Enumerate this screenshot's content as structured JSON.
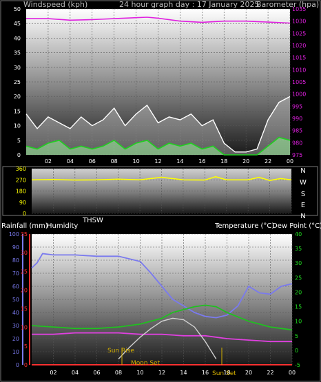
{
  "header": {
    "left": "Windspeed (kph)",
    "center": "24 hour graph day : 17 January 2025",
    "right": "Barometer (hpa)"
  },
  "direction_letters": [
    "N",
    "W",
    "S",
    "E",
    "N"
  ],
  "labels": {
    "rainfall": "Rainfall (mm)",
    "humidity": "Humidity",
    "thsw": "THSW",
    "temperature": "Temperature (°C)",
    "dewpoint": "Dew Point (°C)",
    "sunrise": "Sun Rise",
    "moonset": "Moon Set",
    "sunset": "Sun Set"
  },
  "colors": {
    "barometer": "#e020e0",
    "wind_gust": "#ffffff",
    "wind_avg": "#20d020",
    "wind_dir": "#ffff00",
    "humidity": "#7a7aee",
    "temperature": "#e040e0",
    "dewpoint": "#20c020",
    "solar": "#d0d0d0",
    "rain": "#ff3030"
  },
  "chart_data": [
    {
      "type": "line",
      "x_tick_labels": [
        "02",
        "04",
        "06",
        "08",
        "10",
        "12",
        "14",
        "16",
        "18",
        "20",
        "22",
        "00"
      ],
      "y_left": {
        "label": "Windspeed (kph)",
        "range": [
          0,
          50
        ],
        "ticks": [
          0,
          5,
          10,
          15,
          20,
          25,
          30,
          35,
          40,
          45,
          50
        ]
      },
      "y_right": {
        "label": "Barometer (hpa)",
        "range": [
          975,
          1035
        ],
        "ticks": [
          975,
          980,
          985,
          990,
          995,
          1000,
          1005,
          1010,
          1015,
          1020,
          1025,
          1030,
          1035
        ]
      },
      "series": [
        {
          "name": "Barometer",
          "axis": "right",
          "x": [
            0,
            2,
            4,
            6,
            8,
            10,
            11,
            12,
            14,
            16,
            18,
            20,
            22,
            24
          ],
          "values": [
            1031,
            1031,
            1030.4,
            1030.6,
            1031,
            1031.4,
            1031.6,
            1031.2,
            1030,
            1029.5,
            1030,
            1030,
            1029.6,
            1029.2
          ]
        },
        {
          "name": "Gust",
          "axis": "left",
          "x": [
            0,
            1,
            2,
            3,
            4,
            5,
            6,
            7,
            8,
            9,
            10,
            11,
            12,
            13,
            14,
            15,
            16,
            17,
            18,
            19,
            20,
            21,
            22,
            23,
            24
          ],
          "values": [
            14,
            9,
            13,
            11,
            9,
            13,
            10,
            12,
            16,
            10,
            14,
            17,
            11,
            13,
            12,
            14,
            10,
            12,
            4,
            1,
            1,
            2,
            12,
            18,
            20
          ]
        },
        {
          "name": "Average",
          "axis": "left",
          "x": [
            0,
            1,
            2,
            3,
            4,
            5,
            6,
            7,
            8,
            9,
            10,
            11,
            12,
            13,
            14,
            15,
            16,
            17,
            18,
            19,
            20,
            21,
            22,
            23,
            24
          ],
          "values": [
            3,
            2,
            4,
            5,
            2,
            3,
            2,
            3,
            5,
            2,
            4,
            5,
            2,
            4,
            3,
            4,
            2,
            3,
            0,
            0,
            0,
            0,
            3,
            6,
            5
          ]
        }
      ]
    },
    {
      "type": "line",
      "y_left": {
        "ticks": [
          0,
          90,
          180,
          270,
          360
        ],
        "range": [
          0,
          360
        ]
      },
      "series": [
        {
          "name": "Wind Direction",
          "x": [
            0,
            2,
            4,
            6,
            8,
            10,
            12,
            13,
            14,
            16,
            17,
            18,
            20,
            21,
            22,
            23,
            24
          ],
          "values": [
            270,
            272,
            268,
            270,
            275,
            270,
            290,
            280,
            270,
            268,
            295,
            270,
            270,
            290,
            265,
            280,
            270
          ]
        }
      ]
    },
    {
      "type": "line",
      "x_tick_labels": [
        "02",
        "04",
        "06",
        "08",
        "10",
        "12",
        "14",
        "16",
        "18",
        "20",
        "22",
        "00"
      ],
      "y_humidity": {
        "label": "Humidity",
        "range": [
          0,
          100
        ],
        "ticks": [
          0,
          10,
          20,
          30,
          40,
          50,
          60,
          70,
          80,
          90,
          100
        ]
      },
      "y_rain": {
        "label": "Rainfall (mm)",
        "range": [
          0,
          35
        ],
        "ticks": [
          0,
          5,
          10,
          15,
          20,
          25,
          30,
          35
        ]
      },
      "y_temperature": {
        "label": "Temperature (°C)",
        "range": [
          -5,
          40
        ],
        "ticks": [
          -5,
          0,
          5,
          10,
          15,
          20,
          25,
          30,
          35,
          40
        ]
      },
      "series": [
        {
          "name": "Humidity",
          "axis": "humidity",
          "x": [
            0,
            0.5,
            1,
            2,
            4,
            6,
            8,
            10,
            11,
            12,
            13,
            14,
            15,
            16,
            17,
            18,
            19,
            20,
            21,
            22,
            23,
            24
          ],
          "values": [
            74,
            78,
            85,
            84,
            84,
            83,
            83,
            79,
            70,
            60,
            50,
            45,
            40,
            37,
            36,
            38,
            45,
            60,
            55,
            54,
            60,
            62
          ]
        },
        {
          "name": "Temperature",
          "axis": "temperature",
          "x": [
            0,
            2,
            4,
            6,
            8,
            10,
            12,
            14,
            15,
            16,
            18,
            20,
            22,
            24
          ],
          "values": [
            5.5,
            5.5,
            6,
            6,
            6,
            5.5,
            5.5,
            5,
            5,
            5,
            4,
            3.5,
            3,
            3
          ]
        },
        {
          "name": "Dew Point",
          "axis": "temperature",
          "x": [
            0,
            2,
            4,
            6,
            8,
            10,
            12,
            13,
            14,
            15,
            16,
            17,
            18,
            20,
            22,
            23,
            24
          ],
          "values": [
            8.5,
            8,
            7.5,
            7.5,
            8,
            9,
            11,
            13,
            14,
            15,
            15.5,
            15,
            13,
            10,
            8,
            7.5,
            7
          ]
        },
        {
          "name": "THSW",
          "axis": "temperature",
          "x": [
            8,
            9,
            10,
            11,
            12,
            13,
            14,
            15,
            16,
            17
          ],
          "values": [
            -3,
            1,
            4.5,
            7.5,
            10,
            11,
            10.5,
            8,
            3,
            -3
          ]
        },
        {
          "name": "Rainfall",
          "axis": "rain",
          "x": [
            0,
            24
          ],
          "values": [
            0,
            0
          ]
        }
      ]
    }
  ]
}
